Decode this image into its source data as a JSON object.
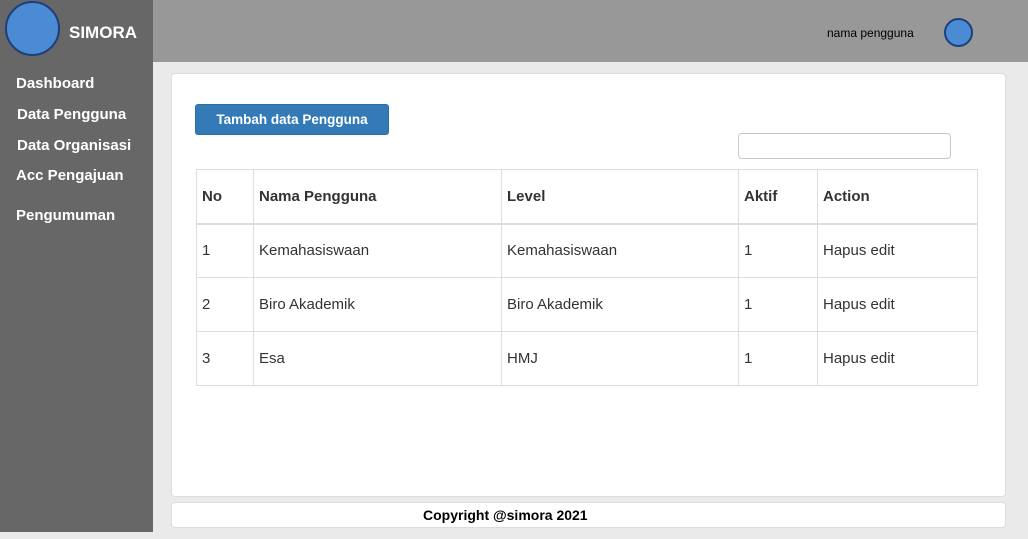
{
  "app": {
    "title": "SIMORA"
  },
  "sidebar": {
    "items": [
      {
        "label": "Dashboard"
      },
      {
        "label": "Data Pengguna"
      },
      {
        "label": "Data Organisasi"
      },
      {
        "label": "Acc Pengajuan"
      },
      {
        "label": "Pengumuman"
      }
    ]
  },
  "header": {
    "user_name": "nama pengguna"
  },
  "main": {
    "add_button_label": "Tambah data Pengguna",
    "search": {
      "value": "",
      "placeholder": ""
    },
    "table": {
      "columns": [
        "No",
        "Nama Pengguna",
        "Level",
        "Aktif",
        "Action"
      ],
      "rows": [
        {
          "no": "1",
          "nama": "Kemahasiswaan",
          "level": "Kemahasiswaan",
          "aktif": "1",
          "hapus": "Hapus",
          "edit": "edit"
        },
        {
          "no": "2",
          "nama": "Biro Akademik",
          "level": "Biro Akademik",
          "aktif": "1",
          "hapus": "Hapus",
          "edit": "edit"
        },
        {
          "no": "3",
          "nama": "Esa",
          "level": "HMJ",
          "aktif": "1",
          "hapus": "Hapus",
          "edit": "edit"
        }
      ]
    }
  },
  "footer": {
    "copyright": "Copyright @simora 2021"
  },
  "colors": {
    "sidebar": "#676767",
    "topbar": "#989898",
    "accent": "#337ab7",
    "avatar": "#4a8bd4"
  }
}
